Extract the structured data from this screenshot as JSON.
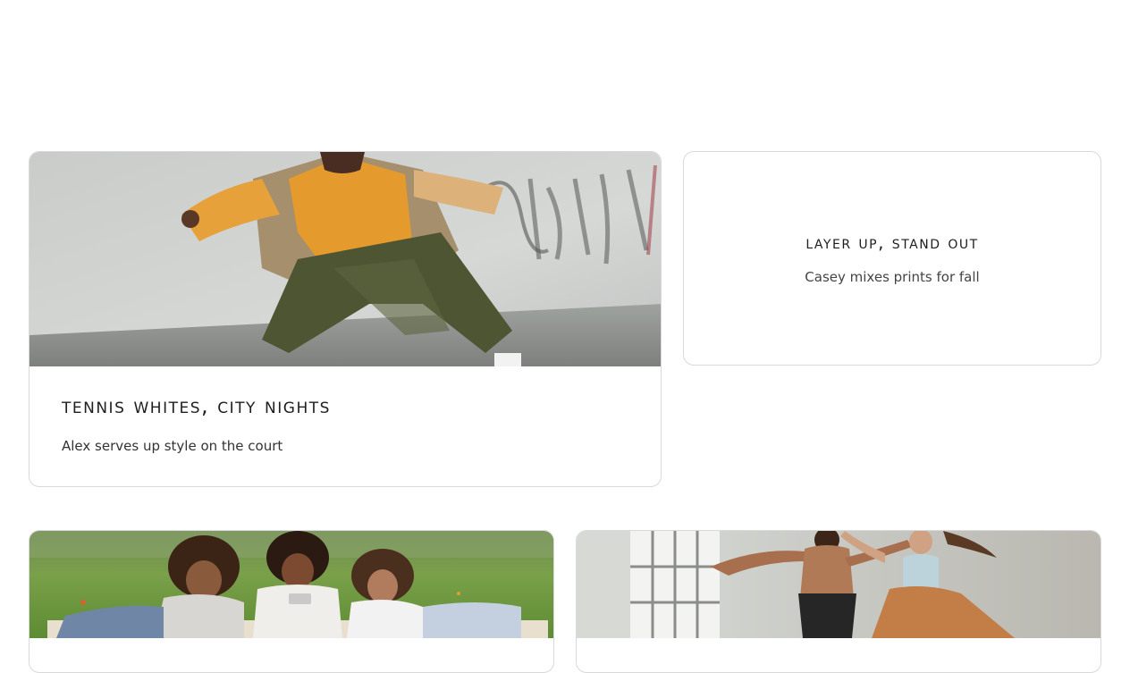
{
  "cards": [
    {
      "image_alt": "dancer in orange hoodie and green pants in front of graffiti wall",
      "title": "Tennis Whites, City Nights",
      "subtitle": "Alex serves up style on the court"
    },
    {
      "title": "Layer Up, Stand Out",
      "subtitle": "Casey mixes prints for fall"
    },
    {
      "image_alt": "three friends lying on grass looking at a phone"
    },
    {
      "image_alt": "two dancers leaping in a bright studio"
    }
  ]
}
